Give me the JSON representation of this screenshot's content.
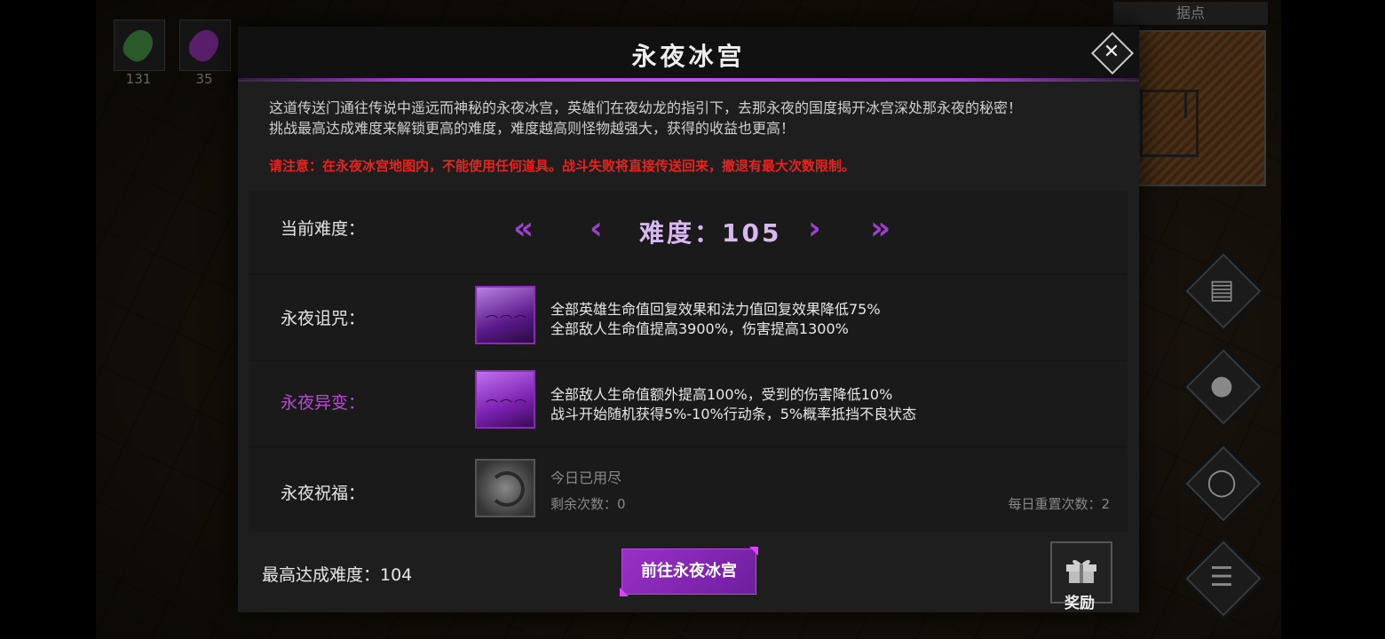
{
  "hud": {
    "resources": [
      {
        "count": "131",
        "color": "#3a8a3a"
      },
      {
        "count": "35",
        "color": "#b040d0"
      }
    ],
    "minimap_title": "据点"
  },
  "modal": {
    "title": "永夜冰宫",
    "description_lines": [
      "这道传送门通往传说中遥远而神秘的永夜冰宫，英雄们在夜幼龙的指引下，去那永夜的国度揭开冰宫深处那永夜的秘密！",
      "挑战最高达成难度来解锁更高的难度，难度越高则怪物越强大，获得的收益也更高！"
    ],
    "warning": "请注意：在永夜冰宫地图内，不能使用任何道具。战斗失败将直接传送回来，撤退有最大次数限制。",
    "difficulty": {
      "label": "当前难度：",
      "value_text": "难度：105"
    },
    "curse": {
      "label": "永夜诅咒：",
      "lines": [
        "全部英雄生命值回复效果和法力值回复效果降低75%",
        "全部敌人生命值提高3900%，伤害提高1300%"
      ]
    },
    "mutation": {
      "label": "永夜异变：",
      "lines": [
        "全部敌人生命值额外提高100%，受到的伤害降低10%",
        "战斗开始随机获得5%-10%行动条，5%概率抵挡不良状态"
      ]
    },
    "blessing": {
      "label": "永夜祝福：",
      "status": "今日已用尽",
      "remaining": "剩余次数：0",
      "daily_reset": "每日重置次数：2"
    },
    "max_difficulty": "最高达成难度：104",
    "go_button": "前往永夜冰宫",
    "reward_label": "奖励"
  },
  "colors": {
    "accent_purple": "#9b40c8",
    "warning_red": "#e8231e",
    "mutation_label": "#b24dcc"
  }
}
